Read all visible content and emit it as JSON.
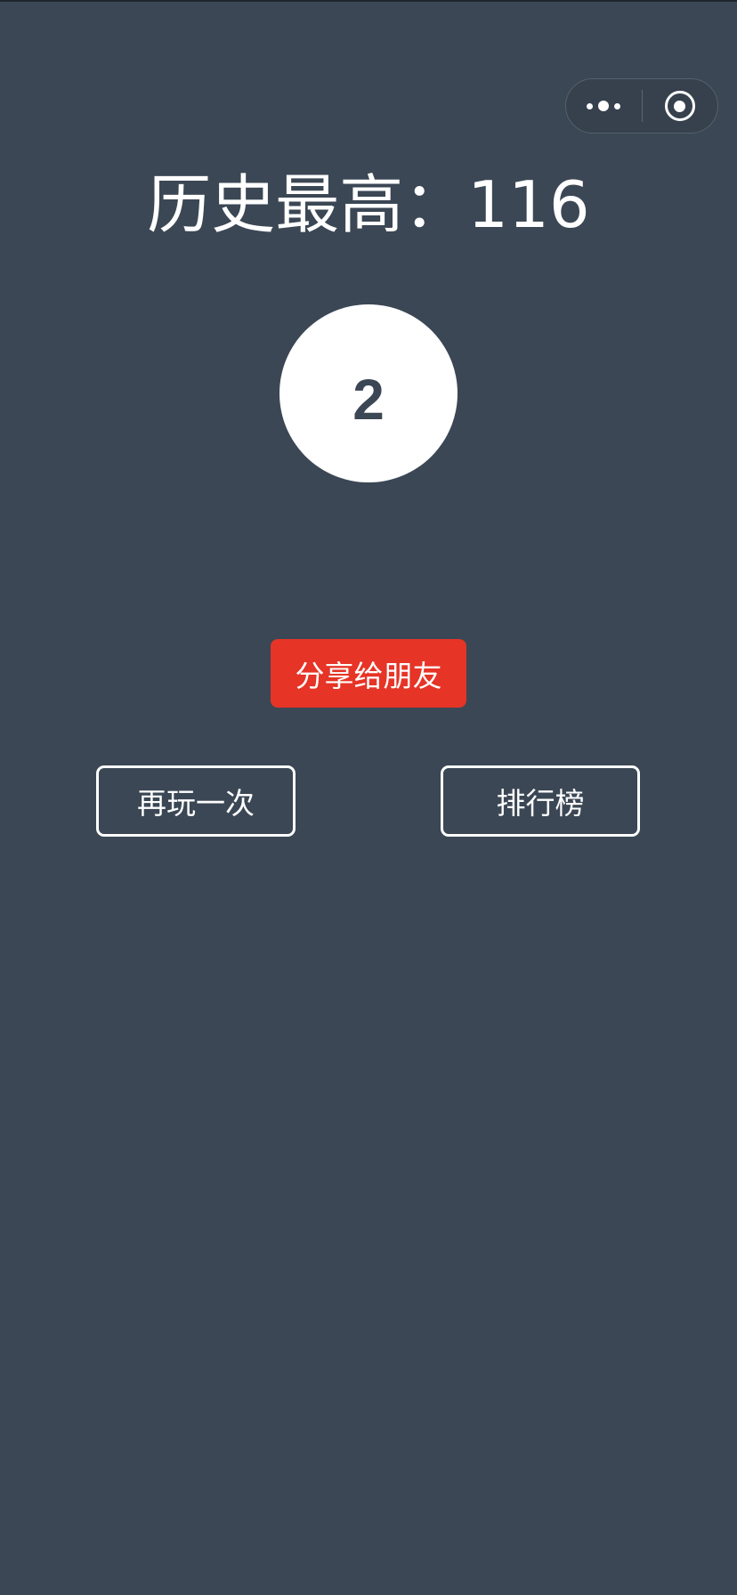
{
  "header": {
    "best_score_label": "历史最高：",
    "best_score_value": "116"
  },
  "current_score": "2",
  "actions": {
    "share_label": "分享给朋友",
    "replay_label": "再玩一次",
    "leaderboard_label": "排行榜"
  },
  "capsule": {
    "menu_icon": "more-dots-icon",
    "close_icon": "target-close-icon"
  },
  "colors": {
    "background": "#3b4754",
    "share_button": "#e63427",
    "text": "#ffffff"
  }
}
